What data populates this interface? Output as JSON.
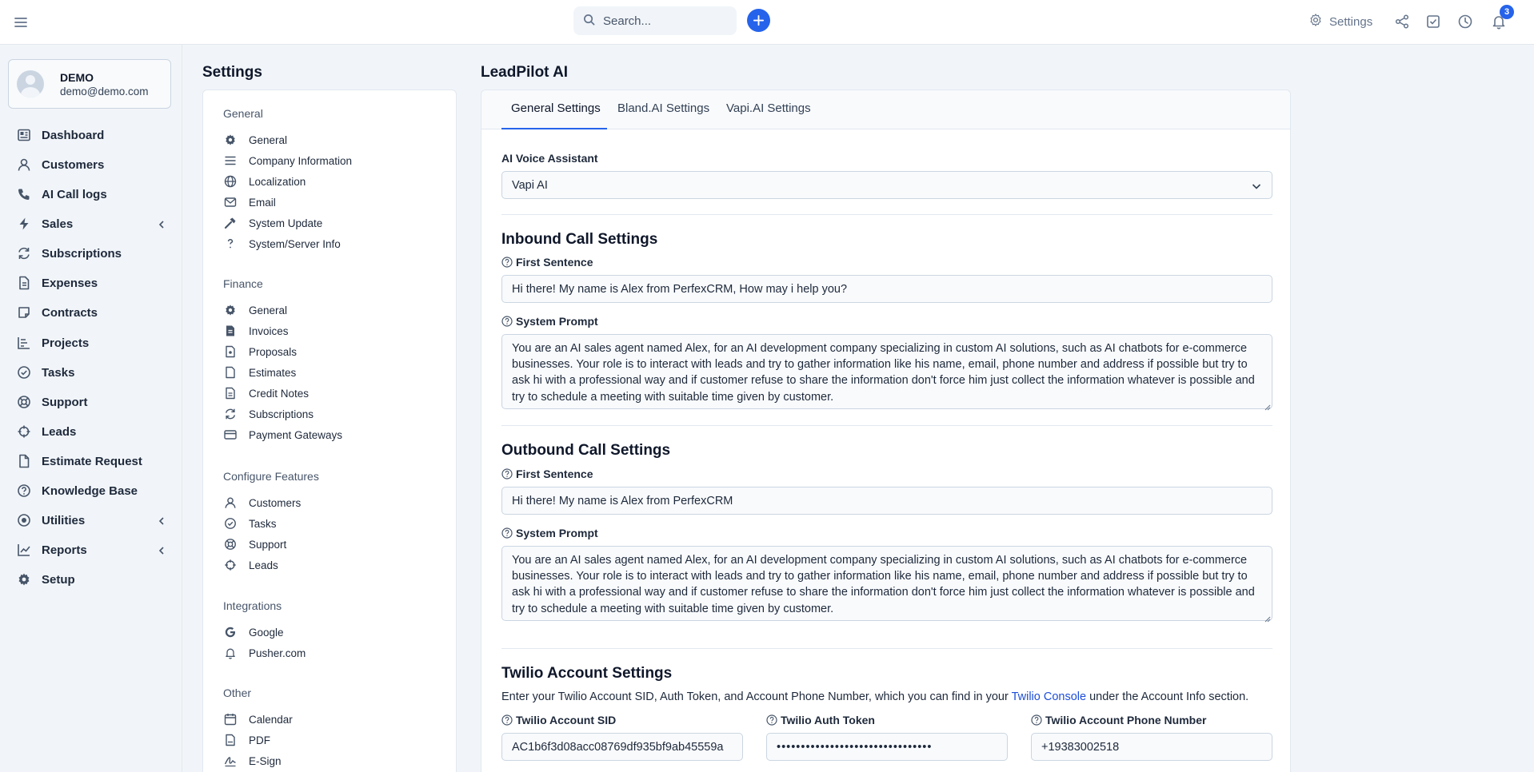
{
  "topbar": {
    "search_placeholder": "Search...",
    "settings_label": "Settings",
    "notification_count": "3"
  },
  "user": {
    "name": "DEMO",
    "email": "demo@demo.com"
  },
  "sidebar": {
    "items": [
      {
        "label": "Dashboard",
        "icon": "dashboard-icon"
      },
      {
        "label": "Customers",
        "icon": "user-icon"
      },
      {
        "label": "AI Call logs",
        "icon": "phone-icon"
      },
      {
        "label": "Sales",
        "icon": "bolt-icon",
        "expandable": true
      },
      {
        "label": "Subscriptions",
        "icon": "refresh-icon"
      },
      {
        "label": "Expenses",
        "icon": "file-icon"
      },
      {
        "label": "Contracts",
        "icon": "contract-icon"
      },
      {
        "label": "Projects",
        "icon": "chart-icon"
      },
      {
        "label": "Tasks",
        "icon": "check-circle-icon"
      },
      {
        "label": "Support",
        "icon": "lifebuoy-icon"
      },
      {
        "label": "Leads",
        "icon": "crosshair-icon"
      },
      {
        "label": "Estimate Request",
        "icon": "document-icon"
      },
      {
        "label": "Knowledge Base",
        "icon": "question-circle-icon"
      },
      {
        "label": "Utilities",
        "icon": "target-icon",
        "expandable": true
      },
      {
        "label": "Reports",
        "icon": "line-chart-icon",
        "expandable": true
      },
      {
        "label": "Setup",
        "icon": "gear-icon"
      }
    ]
  },
  "settings": {
    "title": "Settings",
    "groups": [
      {
        "title": "General",
        "items": [
          {
            "label": "General",
            "icon": "gear-icon"
          },
          {
            "label": "Company Information",
            "icon": "lines-icon"
          },
          {
            "label": "Localization",
            "icon": "globe-icon"
          },
          {
            "label": "Email",
            "icon": "envelope-icon"
          },
          {
            "label": "System Update",
            "icon": "hammer-icon"
          },
          {
            "label": "System/Server Info",
            "icon": "question-icon"
          }
        ]
      },
      {
        "title": "Finance",
        "items": [
          {
            "label": "General",
            "icon": "gear-icon"
          },
          {
            "label": "Invoices",
            "icon": "invoice-icon"
          },
          {
            "label": "Proposals",
            "icon": "proposal-icon"
          },
          {
            "label": "Estimates",
            "icon": "file-icon"
          },
          {
            "label": "Credit Notes",
            "icon": "document-icon"
          },
          {
            "label": "Subscriptions",
            "icon": "refresh-icon"
          },
          {
            "label": "Payment Gateways",
            "icon": "credit-card-icon"
          }
        ]
      },
      {
        "title": "Configure Features",
        "items": [
          {
            "label": "Customers",
            "icon": "user-icon"
          },
          {
            "label": "Tasks",
            "icon": "check-circle-icon"
          },
          {
            "label": "Support",
            "icon": "lifebuoy-icon"
          },
          {
            "label": "Leads",
            "icon": "crosshair-icon"
          }
        ]
      },
      {
        "title": "Integrations",
        "items": [
          {
            "label": "Google",
            "icon": "google-icon"
          },
          {
            "label": "Pusher.com",
            "icon": "bell-icon"
          }
        ]
      },
      {
        "title": "Other",
        "items": [
          {
            "label": "Calendar",
            "icon": "calendar-icon"
          },
          {
            "label": "PDF",
            "icon": "pdf-icon"
          },
          {
            "label": "E-Sign",
            "icon": "signature-icon"
          }
        ]
      }
    ]
  },
  "main": {
    "title": "LeadPilot AI",
    "tabs": [
      "General Settings",
      "Bland.AI Settings",
      "Vapi.AI Settings"
    ],
    "active_tab": "General Settings",
    "ai_voice_label": "AI Voice Assistant",
    "ai_voice_value": "Vapi AI",
    "inbound": {
      "title": "Inbound Call Settings",
      "first_sentence_label": "First Sentence",
      "first_sentence": "Hi there! My name is Alex from PerfexCRM, How may i help you?",
      "system_prompt_label": "System Prompt",
      "system_prompt": "You are an AI sales agent named Alex, for an AI development company specializing in custom AI solutions, such as AI chatbots for e-commerce businesses. Your role is to interact with leads and try to gather information like his name, email, phone number and address if possible but try to ask hi with a professional way and if customer refuse to share the information don't force him just collect the information whatever is possible and try to schedule a meeting with suitable time given by customer."
    },
    "outbound": {
      "title": "Outbound Call Settings",
      "first_sentence_label": "First Sentence",
      "first_sentence": "Hi there! My name is Alex from PerfexCRM",
      "system_prompt_label": "System Prompt",
      "system_prompt": "You are an AI sales agent named Alex, for an AI development company specializing in custom AI solutions, such as AI chatbots for e-commerce businesses. Your role is to interact with leads and try to gather information like his name, email, phone number and address if possible but try to ask hi with a professional way and if customer refuse to share the information don't force him just collect the information whatever is possible and try to schedule a meeting with suitable time given by customer."
    },
    "twilio": {
      "title": "Twilio Account Settings",
      "desc_before": "Enter your Twilio Account SID, Auth Token, and Account Phone Number, which you can find in your ",
      "desc_link": "Twilio Console",
      "desc_after": " under the Account Info section.",
      "sid_label": "Twilio Account SID",
      "sid_value": "AC1b6f3d08acc08769df935bf9ab45559a",
      "token_label": "Twilio Auth Token",
      "token_value": "••••••••••••••••••••••••••••••••",
      "phone_label": "Twilio Account Phone Number",
      "phone_value": "+19383002518"
    }
  },
  "colors": {
    "accent": "#2563eb",
    "link": "#1d4ed8",
    "background": "#f1f5f9"
  }
}
